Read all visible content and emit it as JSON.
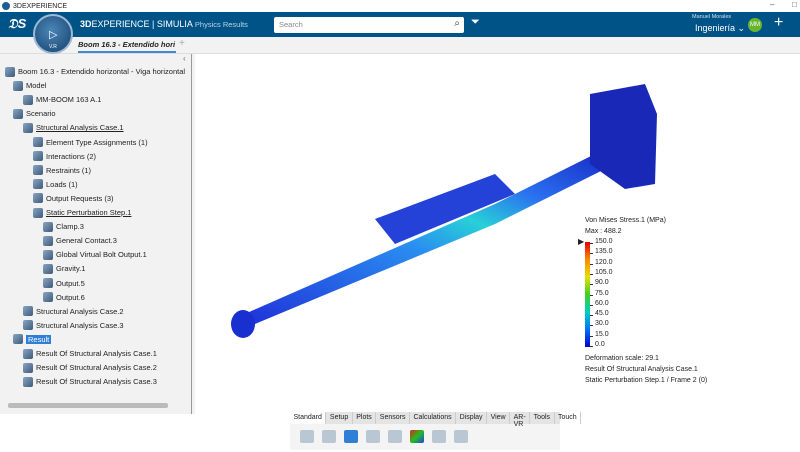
{
  "window": {
    "title": "3DEXPERIENCE"
  },
  "topbar": {
    "brand_bold": "3D",
    "brand_main": "EXPERIENCE | SIMULIA",
    "app": "Physics Results",
    "compass_version": "V.R",
    "search_placeholder": "Search",
    "user_name": "Manuel Morales",
    "role": "Ingeniería",
    "avatar_initials": "MM"
  },
  "tab": {
    "label": "Boom 16.3 - Extendido hori",
    "add": "+"
  },
  "tree": [
    {
      "label": "Boom 16.3 - Extendido horizontal - Viga horizontal",
      "level": 0
    },
    {
      "label": "Model",
      "level": 1
    },
    {
      "label": "MM-BOOM 163 A.1",
      "level": 2
    },
    {
      "label": "Scenario",
      "level": 1
    },
    {
      "label": "Structural Analysis Case.1",
      "level": 2,
      "underline": true
    },
    {
      "label": "Element Type Assignments (1)",
      "level": 3
    },
    {
      "label": "Interactions (2)",
      "level": 3
    },
    {
      "label": "Restraints (1)",
      "level": 3
    },
    {
      "label": "Loads (1)",
      "level": 3
    },
    {
      "label": "Output Requests (3)",
      "level": 3
    },
    {
      "label": "Static Perturbation Step.1",
      "level": 3,
      "underline": true
    },
    {
      "label": "Clamp.3",
      "level": 4
    },
    {
      "label": "General Contact.3",
      "level": 4
    },
    {
      "label": "Global Virtual Bolt Output.1",
      "level": 4
    },
    {
      "label": "Gravity.1",
      "level": 4
    },
    {
      "label": "Output.5",
      "level": 4
    },
    {
      "label": "Output.6",
      "level": 4
    },
    {
      "label": "Structural Analysis Case.2",
      "level": 2
    },
    {
      "label": "Structural Analysis Case.3",
      "level": 2
    },
    {
      "label": "Result",
      "level": 1,
      "selected": true
    },
    {
      "label": "Result Of Structural Analysis Case.1",
      "level": 2
    },
    {
      "label": "Result Of Structural Analysis Case.2",
      "level": 2
    },
    {
      "label": "Result Of Structural Analysis Case.3",
      "level": 2
    }
  ],
  "legend": {
    "title": "Von Mises Stress.1 (MPa)",
    "max": "Max : 488.2",
    "ticks": [
      "150.0",
      "135.0",
      "120.0",
      "105.0",
      "90.0",
      "75.0",
      "60.0",
      "45.0",
      "30.0",
      "15.0",
      "0.0"
    ],
    "deformation": "Deformation scale: 29.1",
    "result": "Result Of Structural Analysis Case.1",
    "step": "Static Perturbation Step.1 / Frame 2 (0)"
  },
  "action_tabs": [
    "Standard",
    "Setup",
    "Plots",
    "Sensors",
    "Calculations",
    "Display",
    "View",
    "AR-VR",
    "Tools",
    "Touch"
  ],
  "colors": {
    "topbar": "#005386",
    "accent": "#2f7fd6"
  }
}
